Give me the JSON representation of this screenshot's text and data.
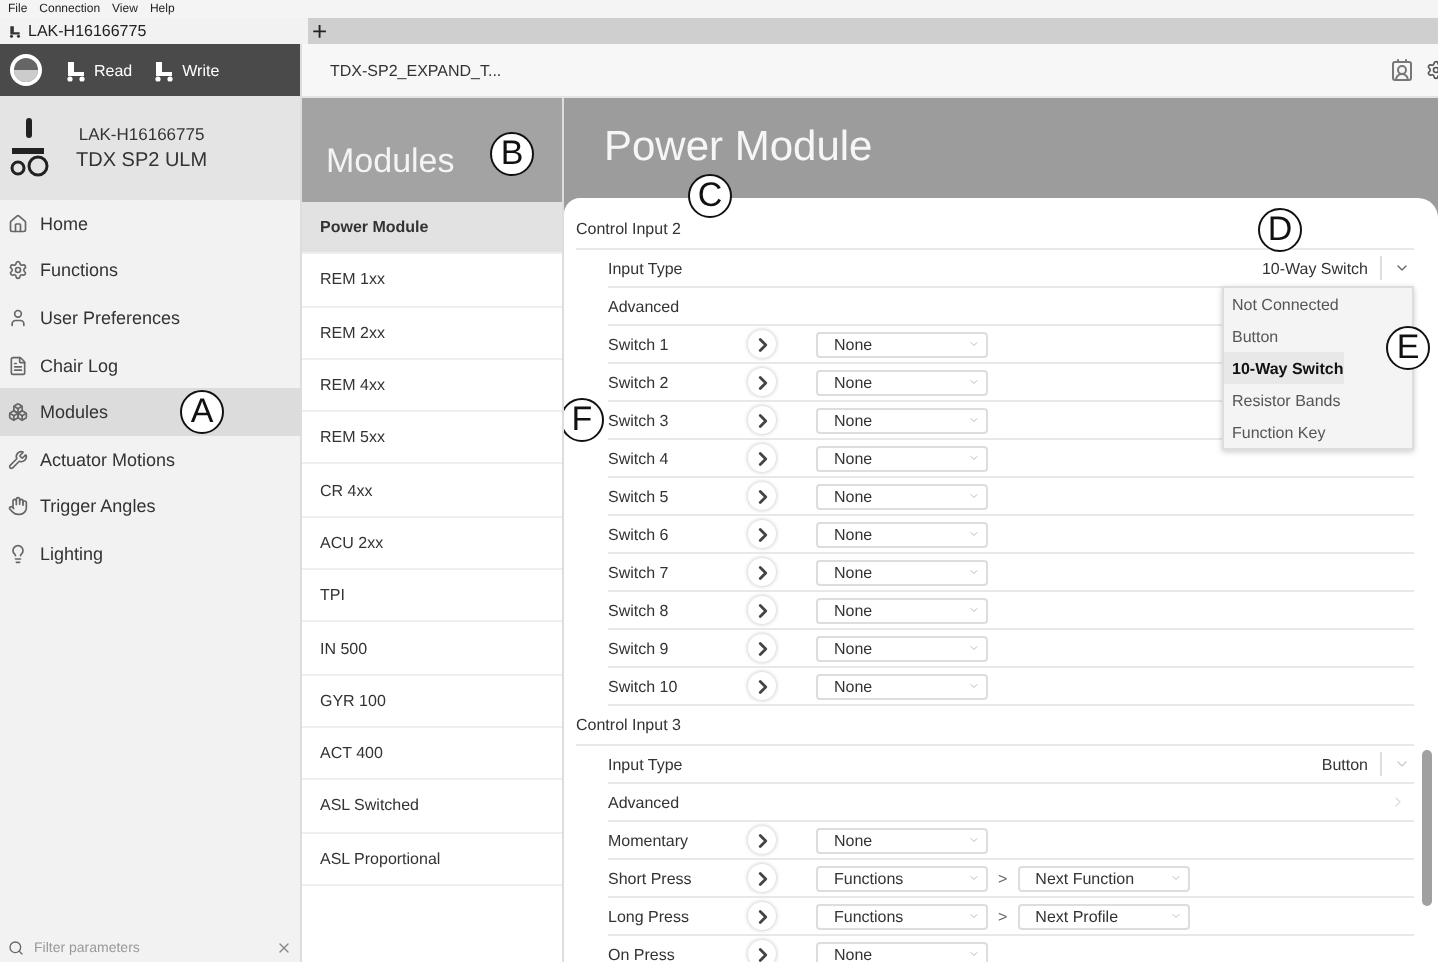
{
  "menu_bar": [
    "File",
    "Connection",
    "View",
    "Help"
  ],
  "doc_tabs": [
    {
      "label": "LAK-H16166775",
      "selected": true
    }
  ],
  "new_tab": "+",
  "toolbar": {
    "read": "Read",
    "write": "Write"
  },
  "breadcrumb": "TDX-SP2_EXPAND_T...",
  "device": {
    "name": "LAK-H16166775",
    "model": "TDX SP2 ULM"
  },
  "nav": [
    {
      "label": "Home",
      "selected": false
    },
    {
      "label": "Functions",
      "selected": false
    },
    {
      "label": "User Preferences",
      "selected": false
    },
    {
      "label": "Chair Log",
      "selected": false
    },
    {
      "label": "Modules",
      "selected": true,
      "callout": "A"
    },
    {
      "label": "Actuator Motions",
      "selected": false
    },
    {
      "label": "Trigger Angles",
      "selected": false
    },
    {
      "label": "Lighting",
      "selected": false
    }
  ],
  "filter": {
    "placeholder": "Filter parameters"
  },
  "modules": {
    "title": "Modules",
    "callout": "B",
    "items": [
      {
        "label": "Power Module",
        "selected": true
      },
      {
        "label": "REM 1xx",
        "selected": false
      },
      {
        "label": "REM 2xx",
        "selected": false
      },
      {
        "label": "REM 4xx",
        "selected": false
      },
      {
        "label": "REM 5xx",
        "selected": false
      },
      {
        "label": "CR 4xx",
        "selected": false
      },
      {
        "label": "ACU 2xx",
        "selected": false
      },
      {
        "label": "TPI",
        "selected": false
      },
      {
        "label": "IN 500",
        "selected": false
      },
      {
        "label": "GYR 100",
        "selected": false
      },
      {
        "label": "ACT 400",
        "selected": false
      },
      {
        "label": "ASL Switched",
        "selected": false
      },
      {
        "label": "ASL Proportional",
        "selected": false
      }
    ]
  },
  "page": {
    "title": "Power Module",
    "callout": "C"
  },
  "sections": [
    {
      "title": "Control Input 2",
      "rows": [
        {
          "kind": "select",
          "label": "Input Type",
          "value": "10-Way Switch",
          "expanded": true,
          "callout": "D",
          "menu": {
            "callout": "E",
            "options": [
              {
                "label": "Not Connected",
                "selected": false
              },
              {
                "label": "Button",
                "selected": false
              },
              {
                "label": "10-Way Switch",
                "selected": true
              },
              {
                "label": "Resistor Bands",
                "selected": false
              },
              {
                "label": "Function Key",
                "selected": false
              }
            ]
          }
        },
        {
          "kind": "link",
          "label": "Advanced"
        },
        {
          "kind": "action",
          "label": "Switch 1",
          "values": [
            "None"
          ]
        },
        {
          "kind": "action",
          "label": "Switch 2",
          "values": [
            "None"
          ]
        },
        {
          "kind": "action",
          "label": "Switch 3",
          "values": [
            "None"
          ],
          "callout": "F"
        },
        {
          "kind": "action",
          "label": "Switch 4",
          "values": [
            "None"
          ]
        },
        {
          "kind": "action",
          "label": "Switch 5",
          "values": [
            "None"
          ]
        },
        {
          "kind": "action",
          "label": "Switch 6",
          "values": [
            "None"
          ]
        },
        {
          "kind": "action",
          "label": "Switch 7",
          "values": [
            "None"
          ]
        },
        {
          "kind": "action",
          "label": "Switch 8",
          "values": [
            "None"
          ]
        },
        {
          "kind": "action",
          "label": "Switch 9",
          "values": [
            "None"
          ]
        },
        {
          "kind": "action",
          "label": "Switch 10",
          "values": [
            "None"
          ]
        }
      ]
    },
    {
      "title": "Control Input 3",
      "rows": [
        {
          "kind": "select",
          "label": "Input Type",
          "value": "Button",
          "expanded": false
        },
        {
          "kind": "link",
          "label": "Advanced"
        },
        {
          "kind": "action",
          "label": "Momentary",
          "values": [
            "None"
          ]
        },
        {
          "kind": "action",
          "label": "Short Press",
          "values": [
            "Functions",
            "Next Function"
          ],
          "separator": ">"
        },
        {
          "kind": "action",
          "label": "Long Press",
          "values": [
            "Functions",
            "Next Profile"
          ],
          "separator": ">"
        },
        {
          "kind": "action",
          "label": "On Press",
          "values": [
            "None"
          ]
        }
      ]
    }
  ]
}
